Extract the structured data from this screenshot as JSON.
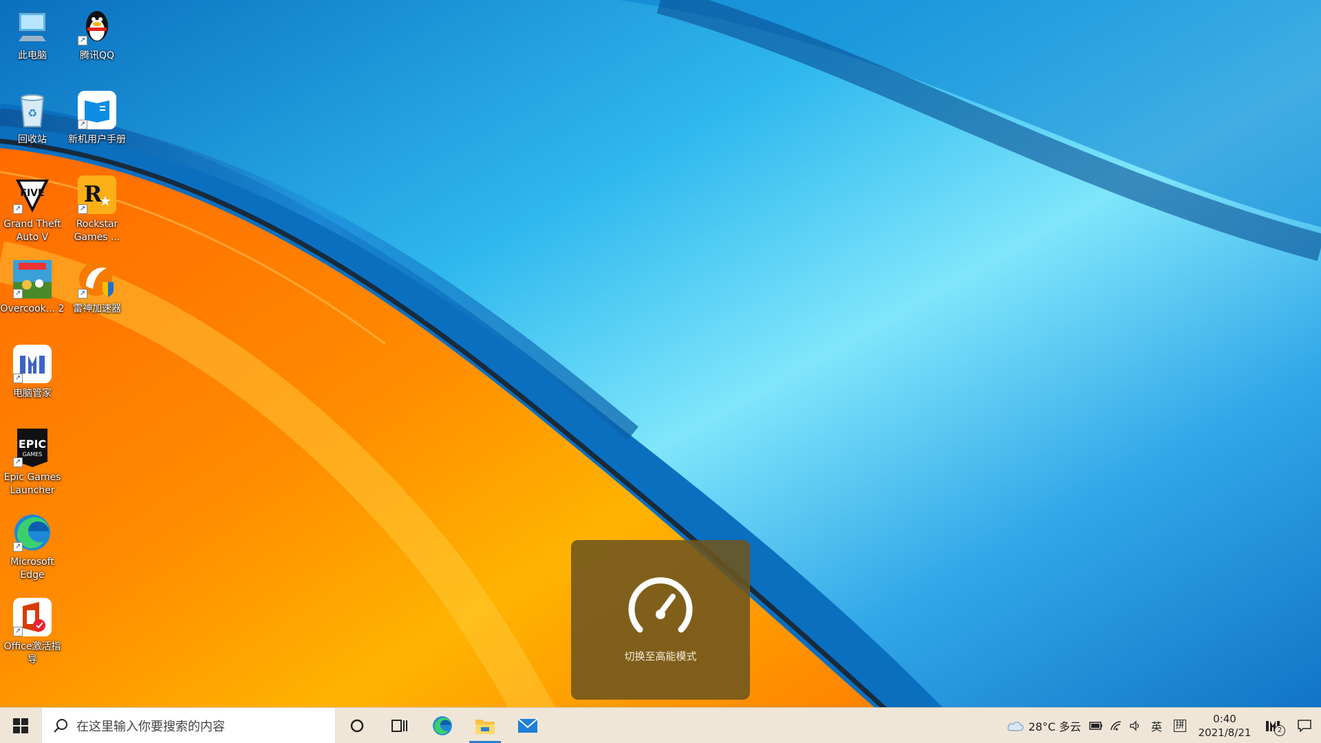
{
  "desktop": {
    "icons": [
      {
        "label": "此电脑"
      },
      {
        "label": "腾讯QQ"
      },
      {
        "label": "回收站"
      },
      {
        "label": "新机用户手册"
      },
      {
        "label": "Grand Theft Auto V"
      },
      {
        "label": "Rockstar Games ..."
      },
      {
        "label": "Overcook... 2"
      },
      {
        "label": "雷神加速器"
      },
      {
        "label": "电脑管家"
      },
      {
        "label": "Epic Games Launcher"
      },
      {
        "label": "Microsoft Edge"
      },
      {
        "label": "Office激活指导"
      }
    ]
  },
  "toast": {
    "text": "切换至高能模式",
    "icon": "speedometer-icon"
  },
  "taskbar": {
    "search_placeholder": "在这里输入你要搜索的内容",
    "apps": [
      "cortana-circle-icon",
      "task-view-icon",
      "edge-icon",
      "file-explorer-icon",
      "mail-icon"
    ],
    "active_app": "file-explorer-icon"
  },
  "tray": {
    "weather": "28°C 多云",
    "lang": "英",
    "ime": "拼",
    "time": "0:40",
    "date": "2021/8/21",
    "notification_count": "2"
  },
  "colors": {
    "taskbar_bg": "#efe6d8",
    "toast_bg": "#6e551e",
    "accent": "#2c7fd0"
  }
}
